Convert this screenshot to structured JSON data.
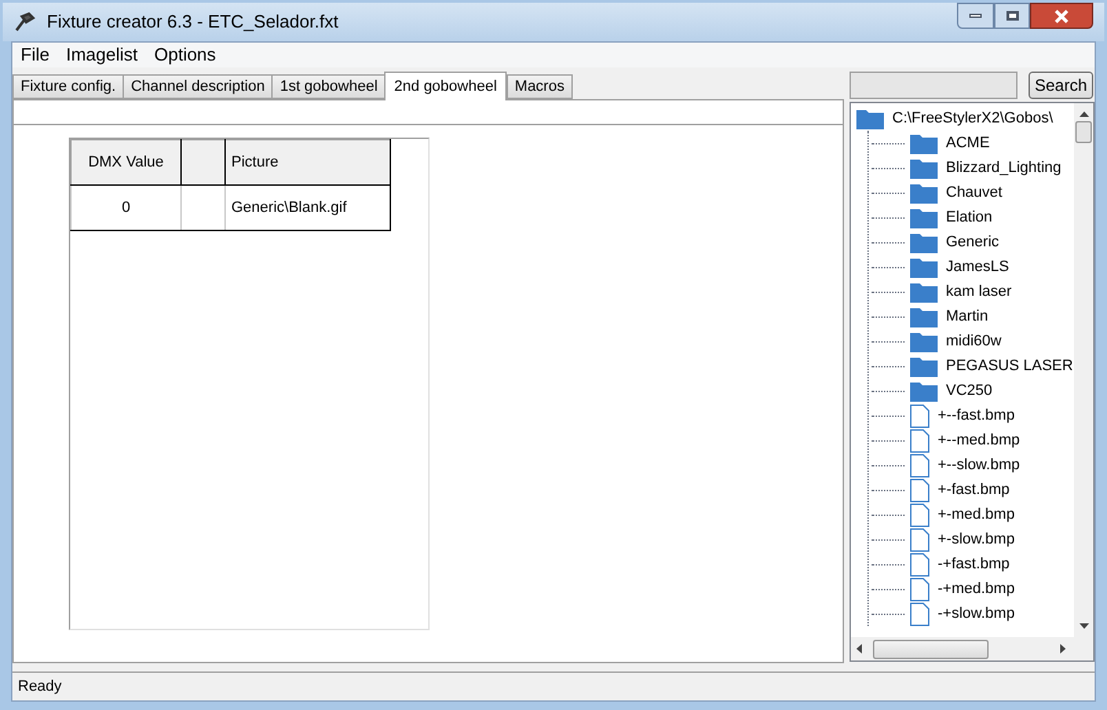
{
  "window": {
    "title": "Fixture creator 6.3 - ETC_Selador.fxt"
  },
  "menu": [
    "File",
    "Imagelist",
    "Options"
  ],
  "tabs": [
    {
      "label": "Fixture config.",
      "selected": false
    },
    {
      "label": "Channel description",
      "selected": false
    },
    {
      "label": "1st gobowheel",
      "selected": false
    },
    {
      "label": "2nd gobowheel",
      "selected": true
    },
    {
      "label": "Macros",
      "selected": false
    }
  ],
  "table": {
    "columns": [
      "DMX Value",
      "",
      "Picture"
    ],
    "rows": [
      [
        "0",
        "",
        "Generic\\Blank.gif"
      ]
    ]
  },
  "search": {
    "button": "Search"
  },
  "tree": {
    "label": "C:\\FreeStylerX2\\Gobos\\",
    "kind": "folder",
    "children": [
      {
        "label": "ACME",
        "kind": "folder"
      },
      {
        "label": "Blizzard_Lighting",
        "kind": "folder"
      },
      {
        "label": "Chauvet",
        "kind": "folder"
      },
      {
        "label": "Elation",
        "kind": "folder"
      },
      {
        "label": "Generic",
        "kind": "folder"
      },
      {
        "label": "JamesLS",
        "kind": "folder"
      },
      {
        "label": "kam laser",
        "kind": "folder"
      },
      {
        "label": "Martin",
        "kind": "folder"
      },
      {
        "label": "midi60w",
        "kind": "folder"
      },
      {
        "label": "PEGASUS LASER",
        "kind": "folder"
      },
      {
        "label": "VC250",
        "kind": "folder"
      },
      {
        "label": "+--fast.bmp",
        "kind": "file"
      },
      {
        "label": "+--med.bmp",
        "kind": "file"
      },
      {
        "label": "+--slow.bmp",
        "kind": "file"
      },
      {
        "label": "+-fast.bmp",
        "kind": "file"
      },
      {
        "label": "+-med.bmp",
        "kind": "file"
      },
      {
        "label": "+-slow.bmp",
        "kind": "file"
      },
      {
        "label": "-+fast.bmp",
        "kind": "file"
      },
      {
        "label": "-+med.bmp",
        "kind": "file"
      },
      {
        "label": "-+slow.bmp",
        "kind": "file"
      }
    ]
  },
  "status_bar": "Ready"
}
